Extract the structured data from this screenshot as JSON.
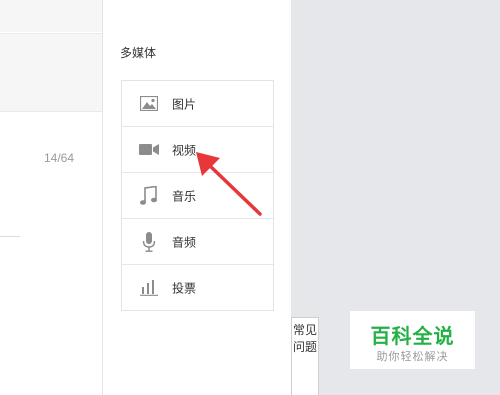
{
  "editor": {
    "word_counter": "14/64"
  },
  "multimedia": {
    "title": "多媒体",
    "items": [
      {
        "label": "图片",
        "icon": "image-icon"
      },
      {
        "label": "视频",
        "icon": "video-camera-icon"
      },
      {
        "label": "音乐",
        "icon": "music-note-icon"
      },
      {
        "label": "音频",
        "icon": "microphone-icon"
      },
      {
        "label": "投票",
        "icon": "bar-chart-icon"
      }
    ]
  },
  "faq": {
    "label": "常见问题"
  },
  "watermark": {
    "title": "百科全说",
    "subtitle": "助你轻松解决"
  },
  "colors": {
    "background": "#e6e7ea",
    "accent_green": "#23b147",
    "arrow_red": "#e8373b"
  }
}
